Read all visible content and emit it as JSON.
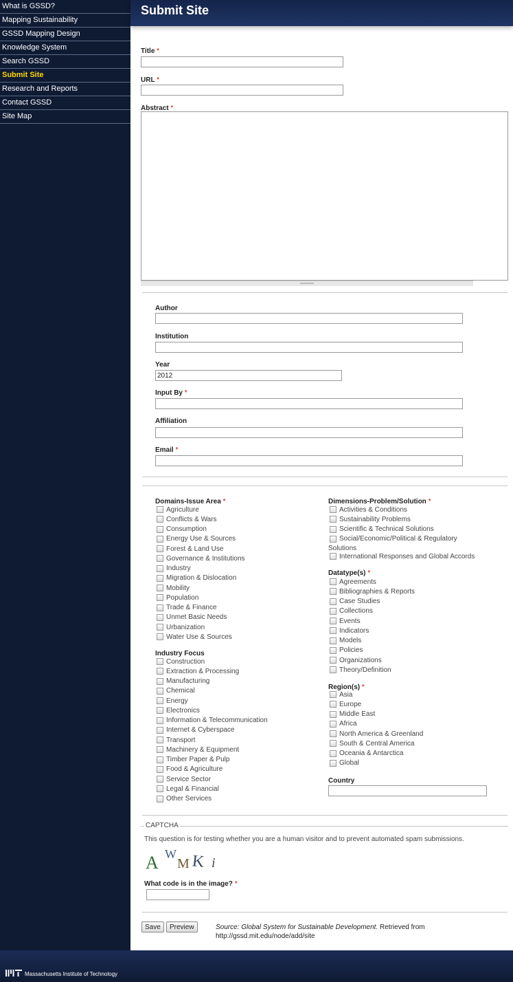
{
  "sidebar": {
    "items": [
      {
        "label": "What is GSSD?",
        "active": false
      },
      {
        "label": "Mapping Sustainability",
        "active": false
      },
      {
        "label": "GSSD Mapping Design",
        "active": false
      },
      {
        "label": "Knowledge System",
        "active": false
      },
      {
        "label": "Search GSSD",
        "active": false
      },
      {
        "label": "Submit Site",
        "active": true
      },
      {
        "label": "Research and Reports",
        "active": false
      },
      {
        "label": "Contact GSSD",
        "active": false
      },
      {
        "label": "Site Map",
        "active": false
      }
    ]
  },
  "page": {
    "title": "Submit Site"
  },
  "form": {
    "required_marker": "*",
    "title_label": "Title",
    "url_label": "URL",
    "abstract_label": "Abstract",
    "author_label": "Author",
    "institution_label": "Institution",
    "year_label": "Year",
    "year_value": "2012",
    "input_by_label": "Input By",
    "affiliation_label": "Affiliation",
    "email_label": "Email",
    "country_label": "Country"
  },
  "domains": {
    "label": "Domains-Issue Area",
    "items": [
      "Agriculture",
      "Conflicts & Wars",
      "Consumption",
      "Energy Use & Sources",
      "Forest & Land Use",
      "Governance & Institutions",
      "Industry",
      "Migration & Dislocation",
      "Mobility",
      "Population",
      "Trade & Finance",
      "Unmet Basic Needs",
      "Urbanization",
      "Water Use & Sources"
    ]
  },
  "industry": {
    "label": "Industry Focus",
    "items": [
      "Construction",
      "Extraction & Processing",
      "Manufacturing",
      "Chemical",
      "Energy",
      "Electronics",
      "Information & Telecommunication",
      "Internet & Cyberspace",
      "Transport",
      "Machinery & Equipment",
      "Timber Paper & Pulp",
      "Food & Agriculture",
      "Service Sector",
      "Legal & Financial",
      "Other Services"
    ]
  },
  "dimensions": {
    "label": "Dimensions-Problem/Solution",
    "items": [
      "Activities & Conditions",
      "Sustainability Problems",
      "Scientific & Technical Solutions",
      "Social/Economic/Political & Regulatory"
    ],
    "wrap_text": "Solutions",
    "last_item": "International Responses and Global Accords"
  },
  "datatypes": {
    "label": "Datatype(s)",
    "items": [
      "Agreements",
      "Bibliographies & Reports",
      "Case Studies",
      "Collections",
      "Events",
      "Indicators",
      "Models",
      "Policies",
      "Organizations",
      "Theory/Definition"
    ]
  },
  "regions": {
    "label": "Region(s)",
    "items": [
      "Asia",
      "Europe",
      "Middle East",
      "Africa",
      "North America & Greenland",
      "South & Central America",
      "Oceania & Antarctica",
      "Global"
    ]
  },
  "captcha": {
    "legend": "CAPTCHA",
    "description": "This question is for testing whether you are a human visitor and to prevent automated spam submissions.",
    "image_text": [
      "A",
      "W",
      "M",
      "K",
      "i"
    ],
    "question": "What code is in the image?"
  },
  "buttons": {
    "save": "Save",
    "preview": "Preview"
  },
  "source": {
    "italic": "Source: Global System for Sustainable Development.",
    "rest": " Retrieved from",
    "url": "http://gssd.mit.edu/node/add/site"
  },
  "footer": {
    "logo": "MIT",
    "text": "Massachusetts Institute of Technology"
  },
  "colors": {
    "sidebar_bg": "#0f1a33",
    "active_nav": "#ffd800",
    "required": "#cc0000",
    "title_bar": "#1a2d5a"
  }
}
